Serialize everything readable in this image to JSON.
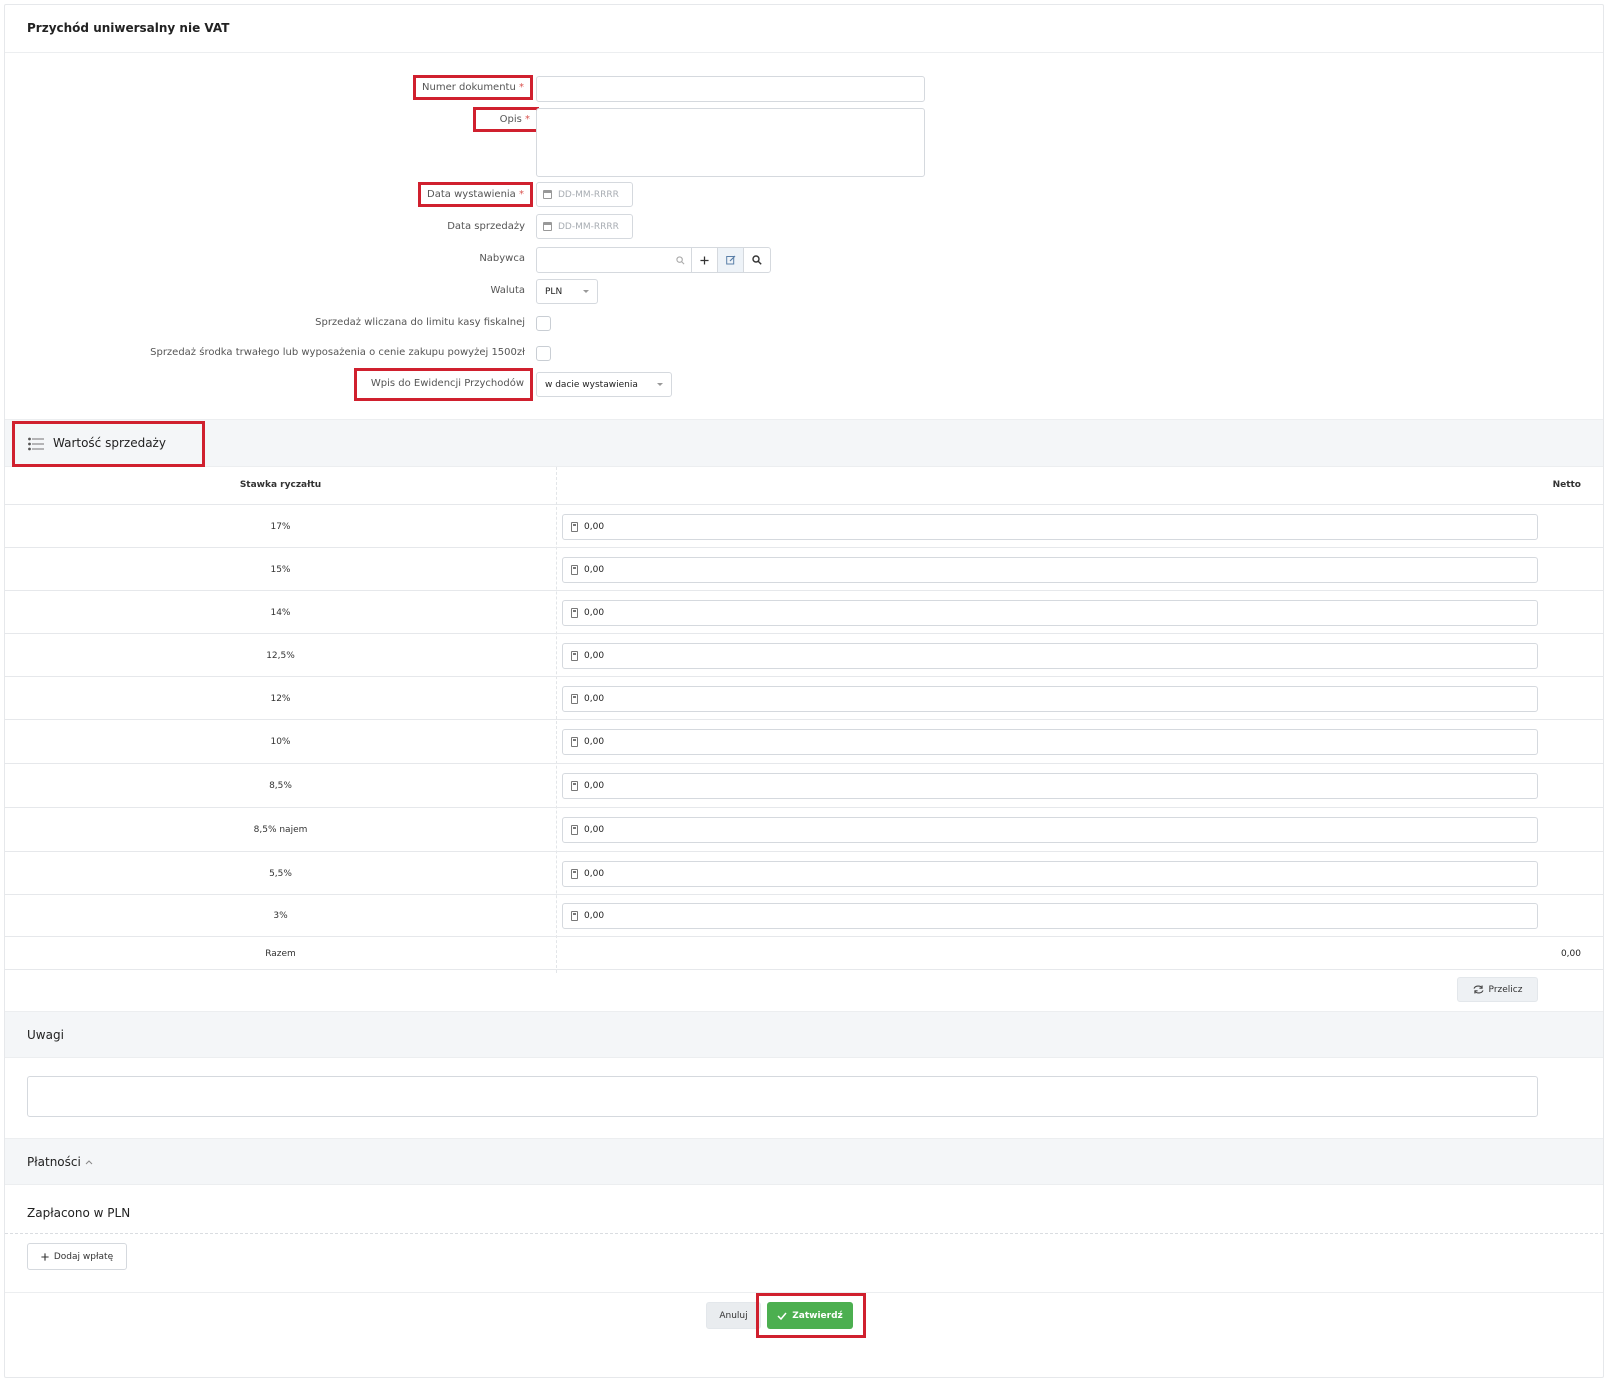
{
  "header": {
    "title": "Przychód uniwersalny nie VAT"
  },
  "form": {
    "numer_label": "Numer dokumentu",
    "opis_label": "Opis",
    "data_wyst_label": "Data wystawienia",
    "data_sprz_label": "Data sprzedaży",
    "date_placeholder": "DD-MM-RRRR",
    "nabywca_label": "Nabywca",
    "waluta_label": "Waluta",
    "waluta_value": "PLN",
    "limit_label": "Sprzedaż wliczana do limitu kasy fiskalnej",
    "srodek_label": "Sprzedaż środka trwałego lub wyposażenia o cenie zakupu powyżej 1500zł",
    "wpis_label": "Wpis do Ewidencji Przychodów",
    "wpis_value": "w dacie wystawienia",
    "required_mark": "*"
  },
  "sales": {
    "title": "Wartość sprzedaży",
    "col_rate": "Stawka ryczałtu",
    "col_net": "Netto",
    "rows": [
      {
        "rate": "17%",
        "value": "0,00"
      },
      {
        "rate": "15%",
        "value": "0,00"
      },
      {
        "rate": "14%",
        "value": "0,00"
      },
      {
        "rate": "12,5%",
        "value": "0,00"
      },
      {
        "rate": "12%",
        "value": "0,00"
      },
      {
        "rate": "10%",
        "value": "0,00"
      },
      {
        "rate": "8,5%",
        "value": "0,00"
      },
      {
        "rate": "8,5% najem",
        "value": "0,00"
      },
      {
        "rate": "5,5%",
        "value": "0,00"
      },
      {
        "rate": "3%",
        "value": "0,00"
      }
    ],
    "total_label": "Razem",
    "total_value": "0,00",
    "recalc_label": "Przelicz"
  },
  "notes": {
    "title": "Uwagi"
  },
  "payments": {
    "title": "Płatności",
    "paid_title": "Zapłacono w PLN",
    "add_label": "Dodaj wpłatę"
  },
  "footer": {
    "cancel_label": "Anuluj",
    "confirm_label": "Zatwierdź"
  }
}
